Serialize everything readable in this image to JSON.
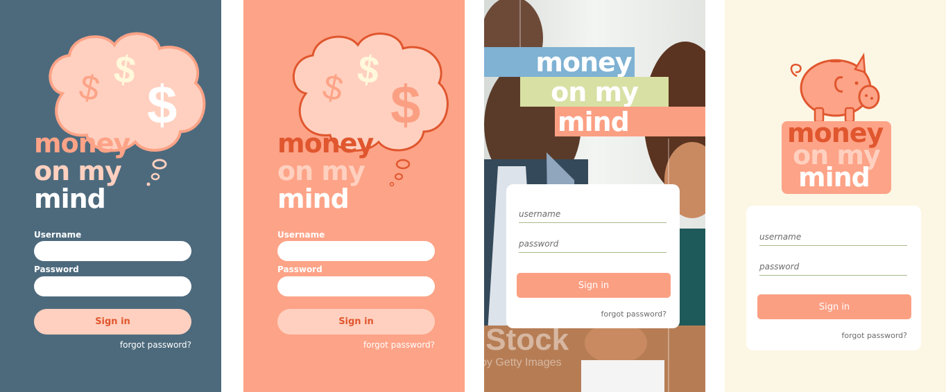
{
  "screens": [
    {
      "theme": "slate",
      "logo": {
        "line1": "money",
        "line2": "on my",
        "line3": "mind"
      },
      "username_label": "Username",
      "password_label": "Password",
      "signin_label": "Sign in",
      "forgot_label": "forgot password?"
    },
    {
      "theme": "salmon",
      "logo": {
        "line1": "money",
        "line2": "on my",
        "line3": "mind"
      },
      "username_label": "Username",
      "password_label": "Password",
      "signin_label": "Sign in",
      "forgot_label": "forgot password?"
    },
    {
      "theme": "photo",
      "logo": {
        "line1": "money",
        "line2": "on my",
        "line3": "mind"
      },
      "watermark": {
        "text1": "iStock",
        "text2": "by Getty Images"
      },
      "username_placeholder": "username",
      "password_placeholder": "password",
      "signin_label": "Sign in",
      "forgot_label": "forgot password?"
    },
    {
      "theme": "cream",
      "logo": {
        "line1": "money",
        "line2": "on my",
        "line3": "mind"
      },
      "username_placeholder": "username",
      "password_placeholder": "password",
      "signin_label": "Sign in",
      "forgot_label": "forgot password?"
    }
  ],
  "icons": [
    "thought-cloud-icon",
    "dollar-sign-icon",
    "piggy-bank-icon"
  ],
  "colors": {
    "slate_bg": "#4d6a7d",
    "salmon_bg": "#fda387",
    "cream_bg": "#fcf6e4",
    "peach_light": "#ffd0bf",
    "orange_dark": "#e0562e",
    "button_salmon": "#fb9f83",
    "band_blue": "#7fb2d3",
    "band_green": "#d9e0a4"
  }
}
